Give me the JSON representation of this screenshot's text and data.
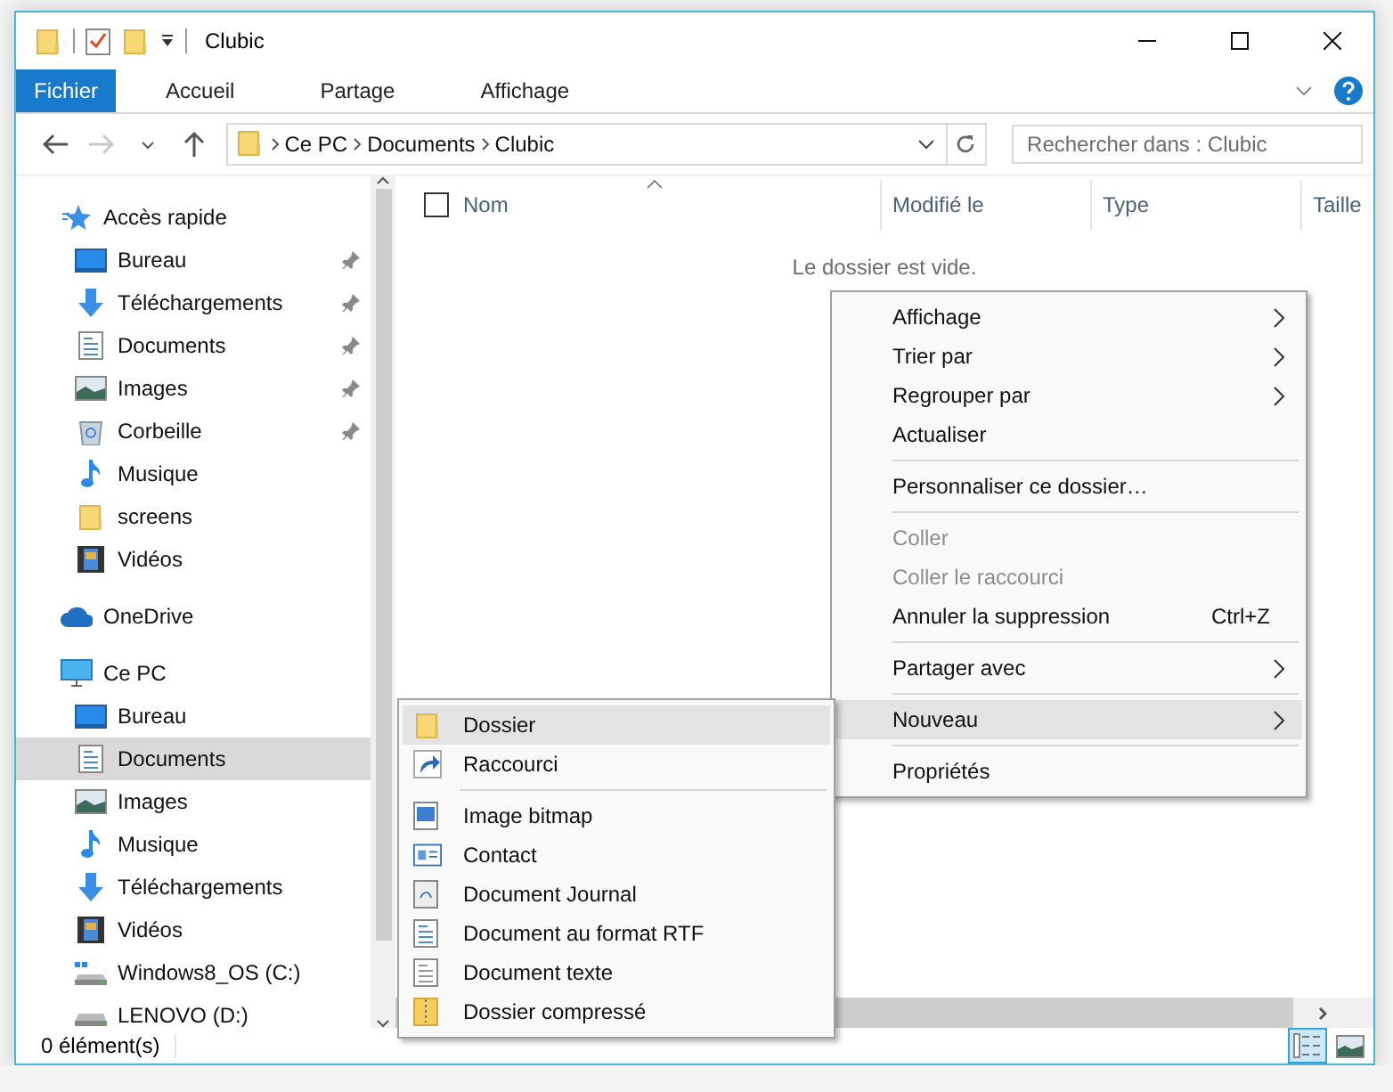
{
  "window": {
    "title": "Clubic"
  },
  "ribbon": {
    "tabs": [
      {
        "label": "Fichier",
        "kind": "file"
      },
      {
        "label": "Accueil",
        "kind": "tab"
      },
      {
        "label": "Partage",
        "kind": "tab"
      },
      {
        "label": "Affichage",
        "kind": "tab"
      }
    ]
  },
  "address_bar": {
    "nav_buttons": [
      {
        "kind": "back",
        "disabled": false
      },
      {
        "kind": "forward",
        "disabled": true
      },
      {
        "kind": "recent",
        "disabled": false
      },
      {
        "kind": "up",
        "disabled": false
      }
    ],
    "breadcrumb": [
      "Ce PC",
      "Documents",
      "Clubic"
    ],
    "search": {
      "placeholder": "Rechercher dans : Clubic"
    }
  },
  "navigation": [
    {
      "label": "Accès rapide",
      "kind": "star",
      "selected": false,
      "children": [
        {
          "label": "Bureau",
          "kind": "desktop",
          "pinned": true,
          "selected": false
        },
        {
          "label": "Téléchargements",
          "kind": "download",
          "pinned": true,
          "selected": false
        },
        {
          "label": "Documents",
          "kind": "document",
          "pinned": true,
          "selected": false
        },
        {
          "label": "Images",
          "kind": "images",
          "pinned": true,
          "selected": false
        },
        {
          "label": "Corbeille",
          "kind": "recycle",
          "pinned": true,
          "selected": false
        },
        {
          "label": "Musique",
          "kind": "music",
          "pinned": false,
          "selected": false
        },
        {
          "label": "screens",
          "kind": "folder",
          "pinned": false,
          "selected": false
        },
        {
          "label": "Vidéos",
          "kind": "video",
          "pinned": false,
          "selected": false
        }
      ]
    },
    {
      "label": "OneDrive",
      "kind": "cloud",
      "selected": false
    },
    {
      "label": "Ce PC",
      "kind": "pc",
      "selected": false,
      "children": [
        {
          "label": "Bureau",
          "kind": "desktop",
          "pinned": false,
          "selected": false
        },
        {
          "label": "Documents",
          "kind": "document",
          "pinned": false,
          "selected": true
        },
        {
          "label": "Images",
          "kind": "images",
          "pinned": false,
          "selected": false
        },
        {
          "label": "Musique",
          "kind": "music",
          "pinned": false,
          "selected": false
        },
        {
          "label": "Téléchargements",
          "kind": "download",
          "pinned": false,
          "selected": false
        },
        {
          "label": "Vidéos",
          "kind": "video",
          "pinned": false,
          "selected": false
        },
        {
          "label": "Windows8_OS (C:)",
          "kind": "drive-windows",
          "pinned": false,
          "selected": false
        },
        {
          "label": "LENOVO (D:)",
          "kind": "drive",
          "pinned": false,
          "selected": false
        }
      ]
    }
  ],
  "file_list": {
    "select_all": {
      "checked": false
    },
    "columns": [
      {
        "label": "Nom",
        "sorted": true
      },
      {
        "label": "Modifié le",
        "sorted": false
      },
      {
        "label": "Type",
        "sorted": false
      },
      {
        "label": "Taille",
        "sorted": false
      }
    ],
    "empty_message": "Le dossier est vide."
  },
  "context_menu": {
    "groups": [
      {
        "items": [
          {
            "label": "Affichage",
            "submenu": true,
            "disabled": false,
            "selected": false
          },
          {
            "label": "Trier par",
            "submenu": true,
            "disabled": false,
            "selected": false
          },
          {
            "label": "Regrouper par",
            "submenu": true,
            "disabled": false,
            "selected": false
          },
          {
            "label": "Actualiser",
            "submenu": false,
            "disabled": false,
            "selected": false
          }
        ]
      },
      {
        "items": [
          {
            "label": "Personnaliser ce dossier…",
            "submenu": false,
            "disabled": false,
            "selected": false
          }
        ]
      },
      {
        "items": [
          {
            "label": "Coller",
            "submenu": false,
            "disabled": true,
            "selected": false
          },
          {
            "label": "Coller le raccourci",
            "submenu": false,
            "disabled": true,
            "selected": false
          },
          {
            "label": "Annuler la suppression",
            "shortcut": "Ctrl+Z",
            "submenu": false,
            "disabled": false,
            "selected": false
          }
        ]
      },
      {
        "items": [
          {
            "label": "Partager avec",
            "submenu": true,
            "disabled": false,
            "selected": false
          }
        ]
      },
      {
        "items": [
          {
            "label": "Nouveau",
            "submenu": true,
            "disabled": false,
            "selected": true
          }
        ]
      },
      {
        "items": [
          {
            "label": "Propriétés",
            "submenu": false,
            "disabled": false,
            "selected": false
          }
        ]
      }
    ]
  },
  "new_submenu": {
    "groups": [
      {
        "items": [
          {
            "label": "Dossier",
            "kind": "folder",
            "selected": true
          },
          {
            "label": "Raccourci",
            "kind": "shortcut",
            "selected": false
          }
        ]
      },
      {
        "items": [
          {
            "label": "Image bitmap",
            "kind": "bitmap",
            "selected": false
          },
          {
            "label": "Contact",
            "kind": "contact",
            "selected": false
          },
          {
            "label": "Document Journal",
            "kind": "journal",
            "selected": false
          },
          {
            "label": "Document au format RTF",
            "kind": "rtf",
            "selected": false
          },
          {
            "label": "Document texte",
            "kind": "text",
            "selected": false
          },
          {
            "label": "Dossier compressé",
            "kind": "zip",
            "selected": false
          }
        ]
      }
    ]
  },
  "status_bar": {
    "text": "0 élément(s)",
    "views": [
      {
        "kind": "details",
        "selected": true
      },
      {
        "kind": "large-icons",
        "selected": false
      }
    ]
  }
}
